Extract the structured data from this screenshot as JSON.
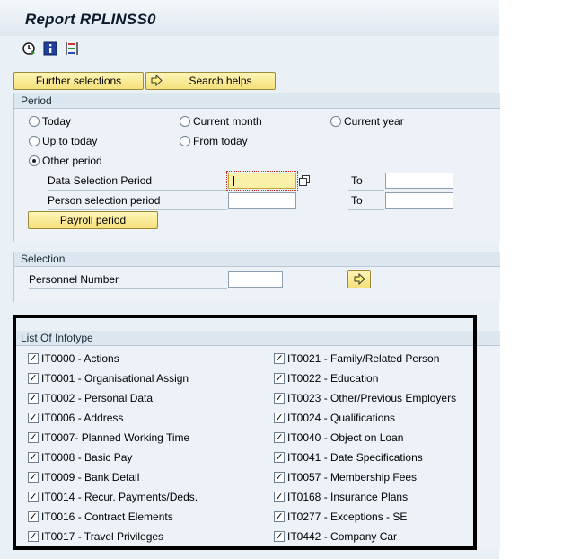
{
  "window": {
    "title": "Report RPLINSS0"
  },
  "toolbar": {
    "icons": [
      "execute-icon",
      "info-icon",
      "variant-list-icon"
    ],
    "further_selections": "Further selections",
    "search_helps": "Search helps"
  },
  "period": {
    "title": "Period",
    "options": {
      "today": "Today",
      "current_month": "Current month",
      "current_year": "Current year",
      "up_to_today": "Up to today",
      "from_today": "From today",
      "other_period": "Other period"
    },
    "selected": "other_period",
    "data_selection_label": "Data Selection Period",
    "person_selection_label": "Person selection period",
    "to_label": "To",
    "data_from": "",
    "data_to": "",
    "person_from": "",
    "person_to": "",
    "payroll_period": "Payroll period"
  },
  "selection": {
    "title": "Selection",
    "personnel_label": "Personnel Number",
    "personnel_value": ""
  },
  "infotypes": {
    "title": "List Of Infotype",
    "left": [
      "IT0000 - Actions",
      "IT0001 - Organisational Assign",
      "IT0002 - Personal Data",
      "IT0006 - Address",
      "IT0007-  Planned Working Time",
      "IT0008 - Basic Pay",
      "IT0009 - Bank Detail",
      "IT0014 - Recur. Payments/Deds.",
      "IT0016 - Contract Elements",
      "IT0017 - Travel Privileges"
    ],
    "right": [
      "IT0021 - Family/Related Person",
      "IT0022 - Education",
      "IT0023 - Other/Previous Employers",
      "IT0024 - Qualifications",
      "IT0040 - Object on Loan",
      "IT0041 - Date Specifications",
      "IT0057 - Membership Fees",
      "IT0168 - Insurance Plans",
      "IT0277 - Exceptions - SE",
      "IT0442 - Company Car"
    ],
    "checked": true
  }
}
